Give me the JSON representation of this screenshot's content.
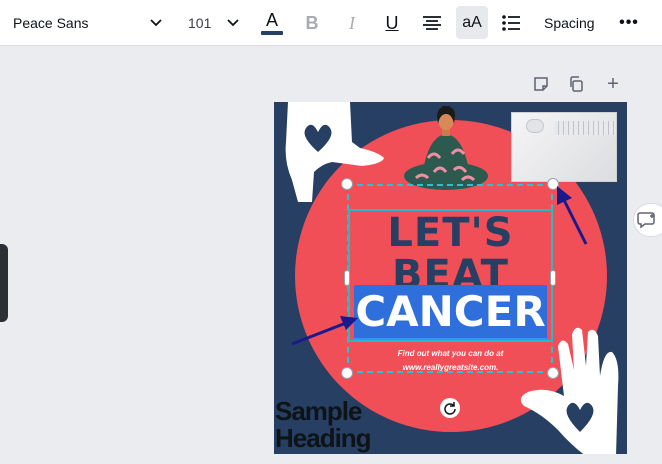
{
  "toolbar": {
    "font_name": "Peace Sans",
    "font_size": "101",
    "text_color_letter": "A",
    "text_color": "#263f63",
    "bold_label": "B",
    "italic_label": "I",
    "underline_label": "U",
    "case_label": "aA",
    "spacing_label": "Spacing",
    "more_label": "•••"
  },
  "page_actions": {
    "add_label": "+"
  },
  "design": {
    "headline_line1": "LET'S",
    "headline_line2": "BEAT",
    "headline_line3": "CANCER",
    "info_line1": "Find out what you can do at",
    "info_line2": "www.reallygreatsite.com.",
    "sample_heading_line1": "Sample",
    "sample_heading_line2": "Heading",
    "colors": {
      "background": "#263f63",
      "circle": "#f04f58",
      "highlight": "#2e6fdc",
      "hand": "#ffffff"
    }
  },
  "selection": {
    "color": "#28c2d1"
  }
}
